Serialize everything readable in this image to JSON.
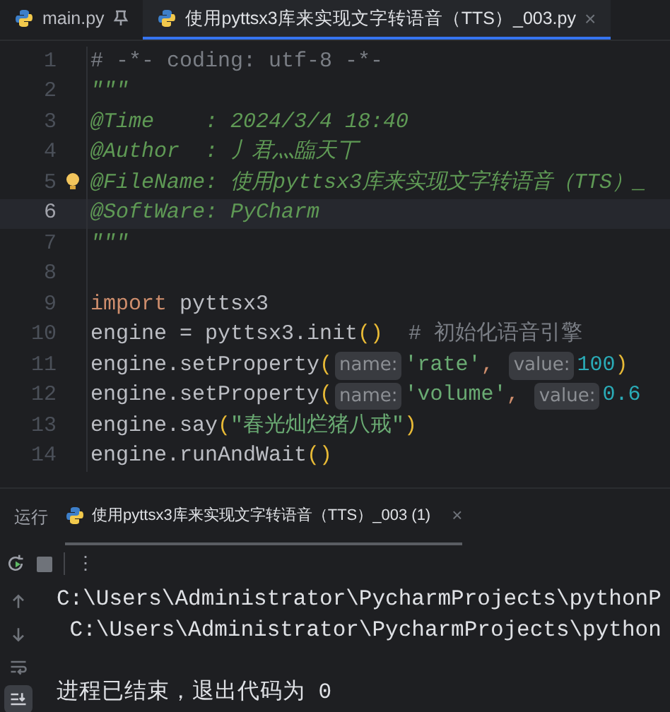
{
  "editor_tabs": [
    {
      "label": "main.py",
      "selected": false,
      "pinned": true,
      "closable": false
    },
    {
      "label": "使用pyttsx3库来实现文字转语音（TTS）_003.py",
      "selected": true,
      "pinned": false,
      "closable": true
    }
  ],
  "close_glyph": "×",
  "code_lines": [
    {
      "number": "1",
      "current": false,
      "bulb": false,
      "tokens": [
        {
          "kind": "comment",
          "text": "# -*- coding: utf-8 -*-"
        }
      ]
    },
    {
      "number": "2",
      "current": false,
      "bulb": false,
      "tokens": [
        {
          "kind": "doc",
          "text": "\"\"\""
        }
      ]
    },
    {
      "number": "3",
      "current": false,
      "bulb": false,
      "tokens": [
        {
          "kind": "doc",
          "text": "@Time    : 2024/3/4 18:40"
        }
      ]
    },
    {
      "number": "4",
      "current": false,
      "bulb": false,
      "tokens": [
        {
          "kind": "doc",
          "text": "@Author  : 丿君灬臨天丅"
        }
      ]
    },
    {
      "number": "5",
      "current": false,
      "bulb": true,
      "tokens": [
        {
          "kind": "doc",
          "text": "@FileName: 使用pyttsx3库来实现文字转语音（TTS）_"
        }
      ]
    },
    {
      "number": "6",
      "current": true,
      "bulb": false,
      "tokens": [
        {
          "kind": "doc",
          "text": "@SoftWare: PyCharm"
        }
      ]
    },
    {
      "number": "7",
      "current": false,
      "bulb": false,
      "tokens": [
        {
          "kind": "doc",
          "text": "\"\"\""
        }
      ]
    },
    {
      "number": "8",
      "current": false,
      "bulb": false
    },
    {
      "number": "9",
      "current": false,
      "bulb": false,
      "tokens": [
        {
          "kind": "keyword",
          "text": "import"
        },
        {
          "kind": "plain",
          "text": " pyttsx3"
        }
      ]
    },
    {
      "number": "10",
      "current": false,
      "bulb": false,
      "tokens": [
        {
          "kind": "plain",
          "text": "engine = pyttsx3.init"
        },
        {
          "kind": "paren",
          "text": "()"
        },
        {
          "kind": "comment",
          "text": "  # 初始化语音引擎"
        }
      ]
    },
    {
      "number": "11",
      "current": false,
      "bulb": false,
      "tokens": [
        {
          "kind": "plain",
          "text": "engine.setProperty"
        },
        {
          "kind": "paren",
          "text": "("
        },
        {
          "kind": "hint",
          "text": "name:"
        },
        {
          "kind": "string",
          "text": "'rate'"
        },
        {
          "kind": "punct",
          "text": ", "
        },
        {
          "kind": "hint",
          "text": "value:"
        },
        {
          "kind": "number",
          "text": "100"
        },
        {
          "kind": "paren",
          "text": ")"
        }
      ]
    },
    {
      "number": "12",
      "current": false,
      "bulb": false,
      "tokens": [
        {
          "kind": "plain",
          "text": "engine.setProperty"
        },
        {
          "kind": "paren",
          "text": "("
        },
        {
          "kind": "hint",
          "text": "name:"
        },
        {
          "kind": "string",
          "text": "'volume'"
        },
        {
          "kind": "punct",
          "text": ", "
        },
        {
          "kind": "hint",
          "text": "value:"
        },
        {
          "kind": "number",
          "text": "0.6"
        }
      ]
    },
    {
      "number": "13",
      "current": false,
      "bulb": false,
      "tokens": [
        {
          "kind": "plain",
          "text": "engine.say"
        },
        {
          "kind": "paren",
          "text": "("
        },
        {
          "kind": "string",
          "text": "\"春光灿烂猪八戒\""
        },
        {
          "kind": "paren",
          "text": ")"
        }
      ]
    },
    {
      "number": "14",
      "current": false,
      "bulb": false,
      "tokens": [
        {
          "kind": "plain",
          "text": "engine.runAndWait"
        },
        {
          "kind": "paren",
          "text": "()"
        }
      ]
    }
  ],
  "run_panel": {
    "title": "运行",
    "tabs": [
      {
        "label": "使用pyttsx3库来实现文字转语音（TTS）_003 (1)",
        "selected": true
      }
    ],
    "more_glyph": "⋮",
    "side_tools": [
      {
        "kind": "up",
        "highlighted": false
      },
      {
        "kind": "down",
        "highlighted": false
      },
      {
        "kind": "wrap",
        "highlighted": false
      },
      {
        "kind": "scroll-end",
        "highlighted": true
      }
    ],
    "console_lines": [
      "C:\\Users\\Administrator\\PycharmProjects\\pythonP",
      " C:\\Users\\Administrator\\PycharmProjects\\python"
    ],
    "exit_message": "进程已结束，退出代码为 0"
  }
}
